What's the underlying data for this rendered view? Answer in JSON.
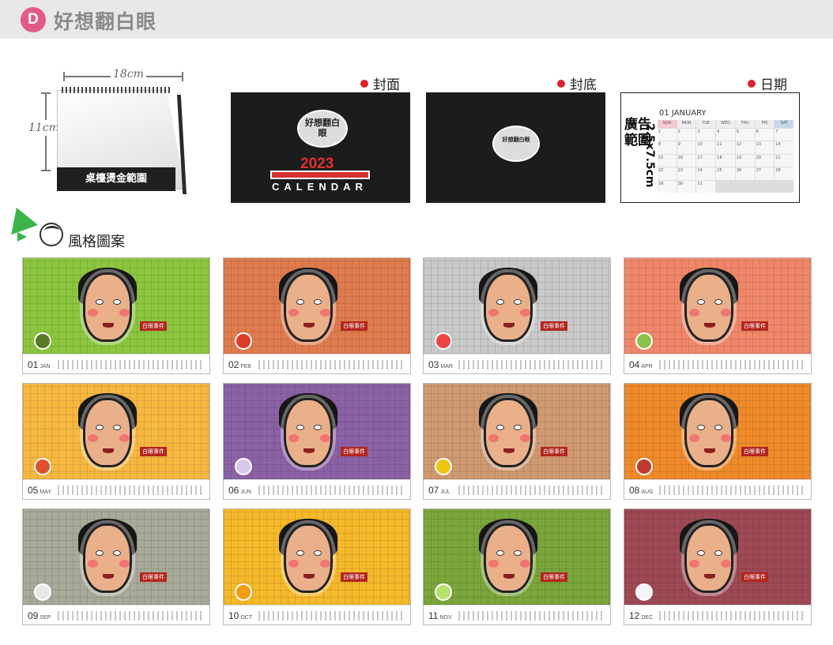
{
  "header": {
    "badge": "D",
    "title": "好想翻白眼"
  },
  "dimensions": {
    "width": "18cm",
    "height": "11cm",
    "print_area": "桌檯燙金範圍"
  },
  "previews": {
    "cover": {
      "label": "封面",
      "art_text": "好想翻白眼",
      "year": "2023",
      "word": "CALENDAR"
    },
    "back": {
      "label": "封底",
      "art_text": "好想翻白眼"
    },
    "date": {
      "label": "日期",
      "ad_label": "廣告範圍",
      "ad_size": "2.5x7.5cm",
      "month": "01 JANUARY",
      "weekdays": [
        "SUN",
        "MON",
        "TUE",
        "WED",
        "THU",
        "FRI",
        "SAT"
      ],
      "days": [
        "1",
        "2",
        "3",
        "4",
        "5",
        "6",
        "7",
        "8",
        "9",
        "10",
        "11",
        "12",
        "13",
        "14",
        "15",
        "16",
        "17",
        "18",
        "19",
        "20",
        "21",
        "22",
        "23",
        "24",
        "25",
        "26",
        "27",
        "28",
        "29",
        "30",
        "31"
      ]
    }
  },
  "style_section": {
    "title": "風格圖案"
  },
  "months": [
    {
      "num": "01",
      "abbr": "JAN",
      "bg": "#8cc63f",
      "fruit": "#5a7a2a"
    },
    {
      "num": "02",
      "abbr": "FEB",
      "bg": "#e07b4e",
      "fruit": "#e03a2a"
    },
    {
      "num": "03",
      "abbr": "MAR",
      "bg": "#c9c9c9",
      "fruit": "#e44"
    },
    {
      "num": "04",
      "abbr": "APR",
      "bg": "#f0876a",
      "fruit": "#8bc34a"
    },
    {
      "num": "05",
      "abbr": "MAY",
      "bg": "#f7b840",
      "fruit": "#e0512a"
    },
    {
      "num": "06",
      "abbr": "JUN",
      "bg": "#8b62a6",
      "fruit": "#d9c7ef"
    },
    {
      "num": "07",
      "abbr": "JUL",
      "bg": "#cf9a72",
      "fruit": "#f1c40f"
    },
    {
      "num": "08",
      "abbr": "AUG",
      "bg": "#ef8a2a",
      "fruit": "#c0392b"
    },
    {
      "num": "09",
      "abbr": "SEP",
      "bg": "#a9a999",
      "fruit": "#e8e8e8"
    },
    {
      "num": "10",
      "abbr": "OCT",
      "bg": "#f6b92b",
      "fruit": "#f39c12"
    },
    {
      "num": "11",
      "abbr": "NOV",
      "bg": "#7aa63c",
      "fruit": "#b5e26a"
    },
    {
      "num": "12",
      "abbr": "DEC",
      "bg": "#9e4a55",
      "fruit": "#f5f5f5"
    }
  ],
  "event_label": "白眼事件"
}
